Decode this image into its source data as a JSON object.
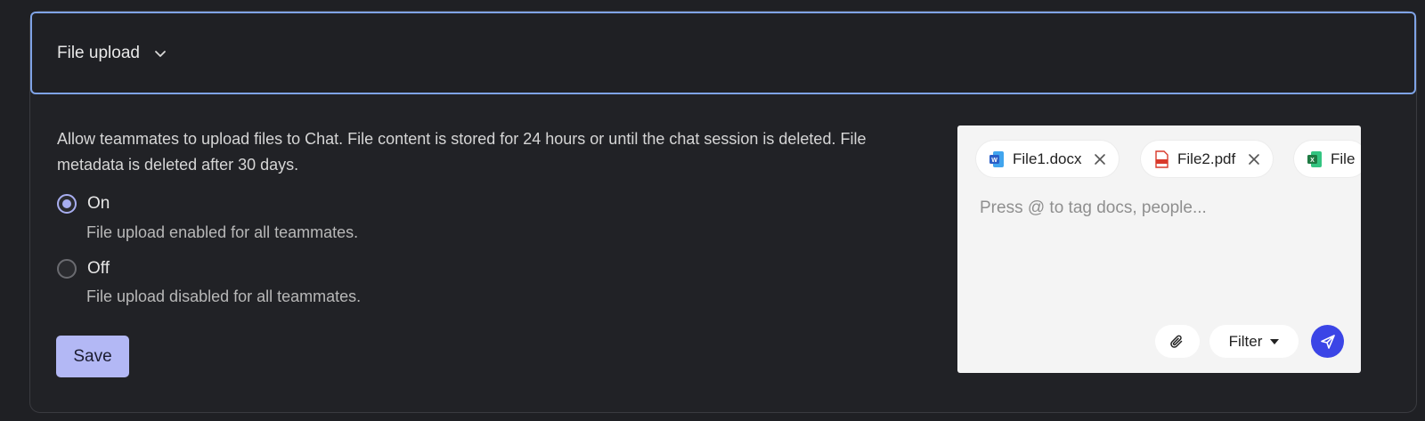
{
  "section": {
    "title": "File upload",
    "description": "Allow teammates to upload files to Chat. File content is stored for 24 hours or until the chat session is deleted. File metadata is deleted after 30 days."
  },
  "options": [
    {
      "label": "On",
      "sublabel": "File upload enabled for all teammates.",
      "checked": true
    },
    {
      "label": "Off",
      "sublabel": "File upload disabled for all teammates.",
      "checked": false
    }
  ],
  "save_label": "Save",
  "preview": {
    "chips": [
      {
        "name": "File1.docx",
        "icon": "word-icon",
        "color": "#2b5fc7"
      },
      {
        "name": "File2.pdf",
        "icon": "pdf-icon",
        "color": "#d93a2b"
      },
      {
        "name": "File",
        "icon": "excel-icon",
        "color": "#1e7a43"
      }
    ],
    "placeholder": "Press @ to tag docs, people...",
    "filter_label": "Filter",
    "send_color": "#3b45e6"
  }
}
